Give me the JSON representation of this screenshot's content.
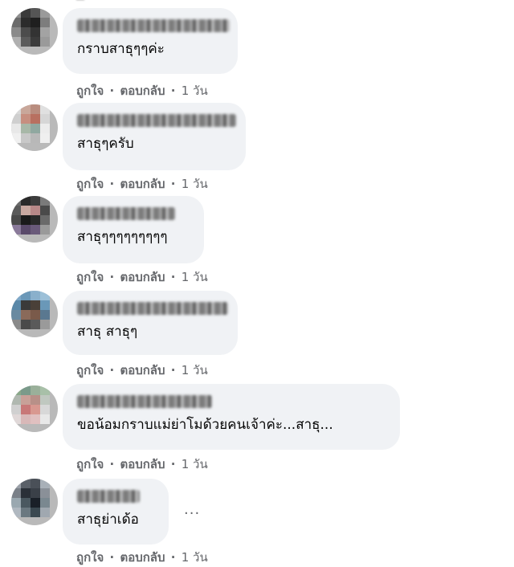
{
  "comments": [
    {
      "text": "กราบสาธุๆๆค่ะ",
      "like": "ถูกใจ",
      "reply": "ตอบกลับ",
      "time": "1 วัน"
    },
    {
      "text": "สาธุๆครับ",
      "like": "ถูกใจ",
      "reply": "ตอบกลับ",
      "time": "1 วัน"
    },
    {
      "text": "สาธุๆๆๆๆๆๆๆๆๆ",
      "like": "ถูกใจ",
      "reply": "ตอบกลับ",
      "time": "1 วัน"
    },
    {
      "text": "สาธุ สาธุๆ",
      "like": "ถูกใจ",
      "reply": "ตอบกลับ",
      "time": "1 วัน"
    },
    {
      "text": "ขอน้อมกราบแม่ย่าโมด้วยคนเจ้าค่ะ...สาธุ...",
      "like": "ถูกใจ",
      "reply": "ตอบกลับ",
      "time": "1 วัน"
    },
    {
      "text": "สาธุย่าเด้อ",
      "like": "ถูกใจ",
      "reply": "ตอบกลับ",
      "time": "1 วัน"
    }
  ],
  "separator": "·",
  "more_options": "...",
  "colors": {
    "bubble": "#f0f2f5",
    "secondary_text": "#65676b",
    "primary_text": "#050505"
  },
  "icons": {
    "more": "more-options-icon",
    "avatar": "blurred-avatar"
  }
}
